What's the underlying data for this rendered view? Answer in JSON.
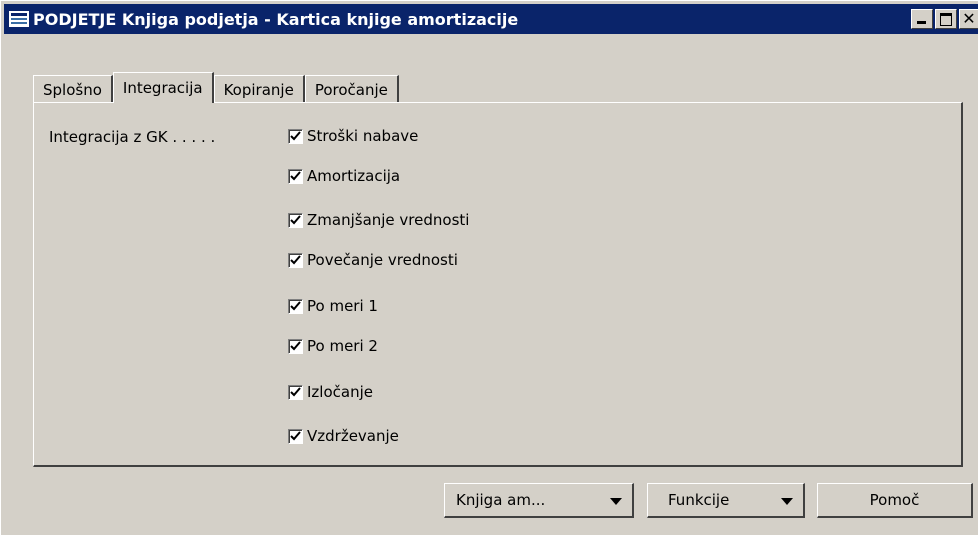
{
  "window": {
    "title": "PODJETJE Knjiga podjetja - Kartica knjige amortizacije",
    "title_bg": "#0a246a"
  },
  "tabs": [
    {
      "label": "Splošno",
      "active": false
    },
    {
      "label": "Integracija",
      "active": true
    },
    {
      "label": "Kopiranje",
      "active": false
    },
    {
      "label": "Poročanje",
      "active": false
    }
  ],
  "integration": {
    "label": "Integracija z GK . . . . .",
    "checkboxes": [
      {
        "label": "Stroški nabave",
        "checked": true
      },
      {
        "label": "Amortizacija",
        "checked": true
      },
      {
        "label": "Zmanjšanje vrednosti",
        "checked": true
      },
      {
        "label": "Povečanje vrednosti",
        "checked": true
      },
      {
        "label": "Po meri 1",
        "checked": true
      },
      {
        "label": "Po meri 2",
        "checked": true
      },
      {
        "label": "Izločanje",
        "checked": true
      },
      {
        "label": "Vzdrževanje",
        "checked": true
      }
    ]
  },
  "buttons": {
    "book": "Knjiga am...",
    "functions": "Funkcije",
    "help": "Pomoč"
  }
}
